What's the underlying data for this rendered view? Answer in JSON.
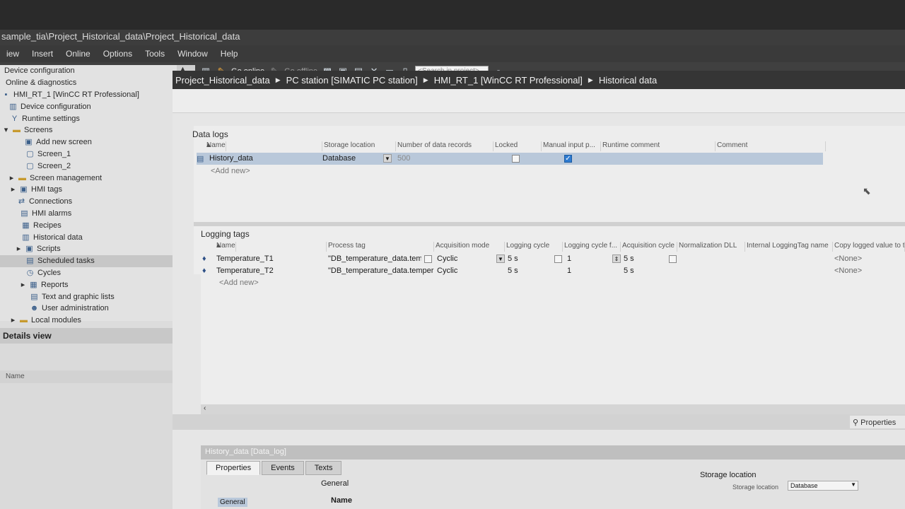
{
  "window": {
    "title": "sample_tia\\Project_Historical_data\\Project_Historical_data"
  },
  "menu": [
    "iew",
    "Insert",
    "Online",
    "Options",
    "Tools",
    "Window",
    "Help"
  ],
  "toolbar": {
    "project_label": "project",
    "go_online": "Go online",
    "go_offline": "Go offline",
    "search_placeholder": "<Search in project>"
  },
  "breadcrumb": [
    "Project_Historical_data",
    "PC station [SIMATIC PC station]",
    "HMI_RT_1 [WinCC RT Professional]",
    "Historical data"
  ],
  "tree": {
    "items": [
      {
        "label": "Device configuration",
        "icon": "device-icon"
      },
      {
        "label": "Online & diagnostics",
        "icon": "diagnostics-icon"
      },
      {
        "label": "HMI_RT_1 [WinCC RT Professional]",
        "icon": "hmi-icon"
      },
      {
        "label": "Device configuration",
        "icon": "device-config-icon"
      },
      {
        "label": "Runtime settings",
        "icon": "runtime-settings-icon"
      },
      {
        "label": "Screens",
        "icon": "folder-icon"
      },
      {
        "label": "Add new screen",
        "icon": "add-screen-icon"
      },
      {
        "label": "Screen_1",
        "icon": "screen-icon"
      },
      {
        "label": "Screen_2",
        "icon": "screen-icon"
      },
      {
        "label": "Screen management",
        "icon": "folder-icon"
      },
      {
        "label": "HMI tags",
        "icon": "tags-icon"
      },
      {
        "label": "Connections",
        "icon": "connections-icon"
      },
      {
        "label": "HMI alarms",
        "icon": "alarms-icon"
      },
      {
        "label": "Recipes",
        "icon": "recipes-icon"
      },
      {
        "label": "Historical data",
        "icon": "historical-data-icon"
      },
      {
        "label": "Scripts",
        "icon": "scripts-icon"
      },
      {
        "label": "Scheduled tasks",
        "icon": "scheduled-tasks-icon"
      },
      {
        "label": "Cycles",
        "icon": "cycles-icon"
      },
      {
        "label": "Reports",
        "icon": "reports-icon"
      },
      {
        "label": "Text and graphic lists",
        "icon": "text-lists-icon"
      },
      {
        "label": "User administration",
        "icon": "user-admin-icon"
      },
      {
        "label": "Local modules",
        "icon": "local-modules-icon"
      }
    ]
  },
  "details": {
    "title": "Details view",
    "column_name": "Name"
  },
  "data_logs": {
    "title": "Data logs",
    "headers": [
      "Name",
      "Storage location",
      "Number of data records",
      "Locked",
      "Manual input p...",
      "Runtime comment",
      "Comment"
    ],
    "rows": [
      {
        "name": "History_data",
        "storage": "Database",
        "records": "500",
        "locked": false,
        "manual": true
      }
    ],
    "add_new": "<Add new>"
  },
  "logging_tags": {
    "title": "Logging tags",
    "headers": [
      "Name",
      "Process tag",
      "Acquisition mode",
      "Logging cycle",
      "Logging cycle f...",
      "Acquisition cycle",
      "Normalization DLL",
      "Internal LoggingTag name",
      "Copy logged value to tag"
    ],
    "rows": [
      {
        "name": "Temperature_T1",
        "process_tag": "\"DB_temperature_data.tem",
        "mode": "Cyclic",
        "cycle": "5 s",
        "factor": "1",
        "acq": "5 s",
        "copy": "<None>"
      },
      {
        "name": "Temperature_T2",
        "process_tag": "\"DB_temperature_data.temper",
        "mode": "Cyclic",
        "cycle": "5 s",
        "factor": "1",
        "acq": "5 s",
        "copy": "<None>"
      }
    ],
    "add_new": "<Add new>"
  },
  "properties_button": "Properties",
  "inspector": {
    "title": "History_data [Data_log]",
    "tabs": [
      "Properties",
      "Events",
      "Texts"
    ],
    "nav_general": "General",
    "section_general": "General",
    "field_name": "Name",
    "storage_section": "Storage location",
    "storage_label": "Storage location",
    "storage_value": "Database"
  }
}
